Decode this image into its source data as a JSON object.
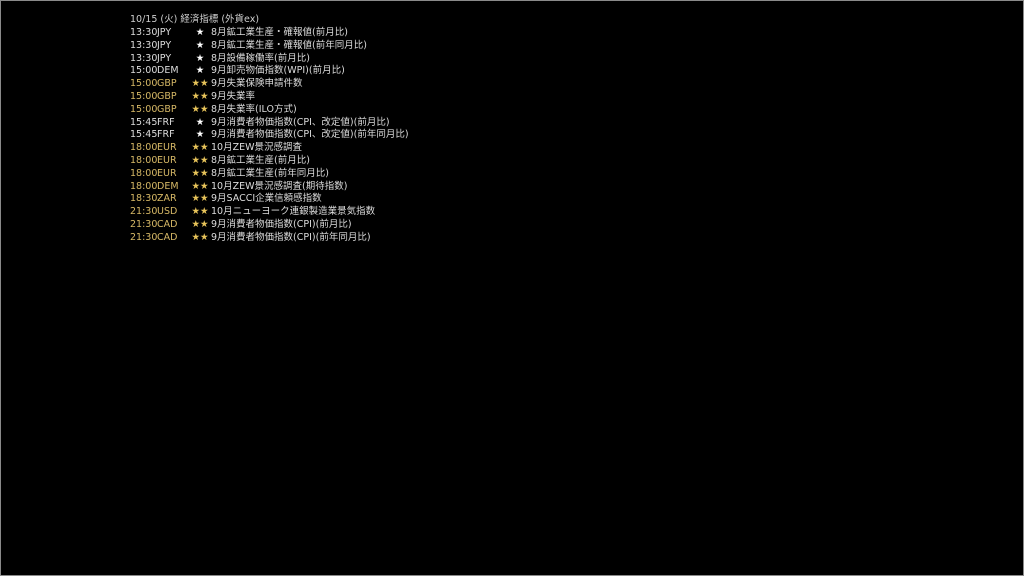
{
  "header": {
    "title": "10/15 (火) 経済指標 (外貨ex)"
  },
  "colors": {
    "background": "#000000",
    "normal_text": "#dcdcdc",
    "high_importance": "#d6b866",
    "star_gold": "#e8c45a"
  },
  "events": [
    {
      "time": "13:30",
      "currency": "JPY",
      "stars": "★",
      "importance": 1,
      "name": "8月鉱工業生産・確報値(前月比)"
    },
    {
      "time": "13:30",
      "currency": "JPY",
      "stars": "★",
      "importance": 1,
      "name": "8月鉱工業生産・確報値(前年同月比)"
    },
    {
      "time": "13:30",
      "currency": "JPY",
      "stars": "★",
      "importance": 1,
      "name": "8月設備稼働率(前月比)"
    },
    {
      "time": "15:00",
      "currency": "DEM",
      "stars": "★",
      "importance": 1,
      "name": "9月卸売物価指数(WPI)(前月比)"
    },
    {
      "time": "15:00",
      "currency": "GBP",
      "stars": "★★",
      "importance": 2,
      "name": "9月失業保険申請件数"
    },
    {
      "time": "15:00",
      "currency": "GBP",
      "stars": "★★",
      "importance": 2,
      "name": "9月失業率"
    },
    {
      "time": "15:00",
      "currency": "GBP",
      "stars": "★★",
      "importance": 2,
      "name": "8月失業率(ILO方式)"
    },
    {
      "time": "15:45",
      "currency": "FRF",
      "stars": "★",
      "importance": 1,
      "name": "9月消費者物価指数(CPI、改定値)(前月比)"
    },
    {
      "time": "15:45",
      "currency": "FRF",
      "stars": "★",
      "importance": 1,
      "name": "9月消費者物価指数(CPI、改定値)(前年同月比)"
    },
    {
      "time": "18:00",
      "currency": "EUR",
      "stars": "★★",
      "importance": 2,
      "name": "10月ZEW景況感調査"
    },
    {
      "time": "18:00",
      "currency": "EUR",
      "stars": "★★",
      "importance": 2,
      "name": "8月鉱工業生産(前月比)"
    },
    {
      "time": "18:00",
      "currency": "EUR",
      "stars": "★★",
      "importance": 2,
      "name": "8月鉱工業生産(前年同月比)"
    },
    {
      "time": "18:00",
      "currency": "DEM",
      "stars": "★★",
      "importance": 2,
      "name": "10月ZEW景況感調査(期待指数)"
    },
    {
      "time": "18:30",
      "currency": "ZAR",
      "stars": "★★",
      "importance": 2,
      "name": "9月SACCI企業信頼感指数"
    },
    {
      "time": "21:30",
      "currency": "USD",
      "stars": "★★",
      "importance": 2,
      "name": "10月ニューヨーク連銀製造業景気指数"
    },
    {
      "time": "21:30",
      "currency": "CAD",
      "stars": "★★",
      "importance": 2,
      "name": "9月消費者物価指数(CPI)(前月比)"
    },
    {
      "time": "21:30",
      "currency": "CAD",
      "stars": "★★",
      "importance": 2,
      "name": "9月消費者物価指数(CPI)(前年同月比)"
    }
  ]
}
